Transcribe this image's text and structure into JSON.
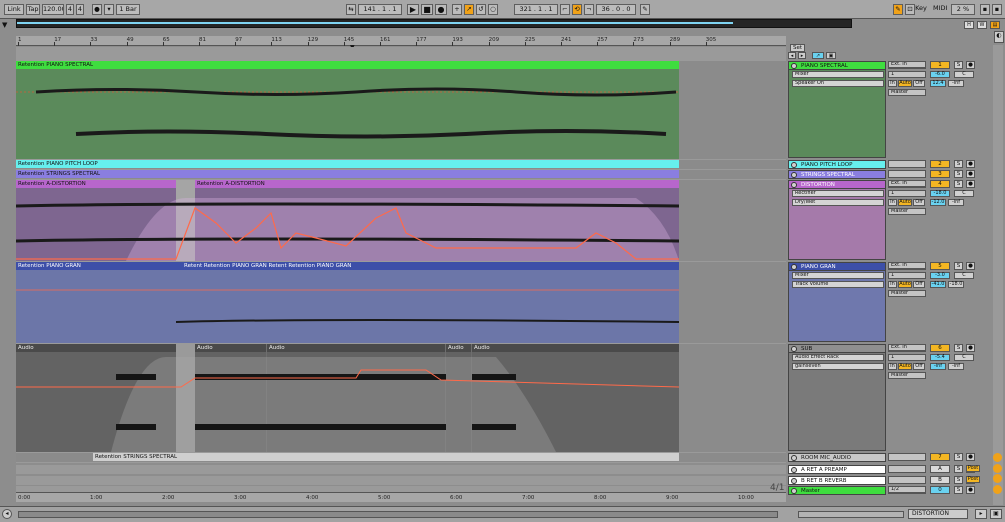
{
  "transport": {
    "link": "Link",
    "tap": "Tap",
    "tempo": "120.00",
    "sig_num": "4",
    "sig_den": "4",
    "metro": "1 Bar",
    "position": "141 . 1 . 1",
    "loop_start": "321 . 1 . 1",
    "loop_length": "36 . 0 . 0",
    "key": "Key",
    "midi": "MIDI",
    "cpu": "2 %",
    "d_label": "D"
  },
  "ruler_bars": [
    "1",
    "17",
    "33",
    "49",
    "65",
    "81",
    "97",
    "113",
    "129",
    "145",
    "161",
    "177",
    "193",
    "209",
    "225",
    "241",
    "257",
    "273",
    "289",
    "305"
  ],
  "time_marks": [
    "0:00",
    "1:00",
    "2:00",
    "3:00",
    "4:00",
    "5:00",
    "6:00",
    "7:00",
    "8:00",
    "9:00",
    "10:00"
  ],
  "set_label": "Set",
  "clips": {
    "spectral": "Retention PIANO SPECTRAL",
    "pitch": "Retention PIANO PITCH LOOP",
    "strings": "Retention STRINGS SPECTRAL",
    "dist1": "Retention A-DISTORTION",
    "dist2": "Retention A-DISTORTION",
    "gran1": "Retention PIANO GRAN",
    "gran2": "Retent Retention PIANO GRAN Retent Retention PIANO GRAN",
    "audio1": "Audio",
    "audio2": "Audio",
    "audio3": "Audio",
    "audio4": "Audio",
    "audio5": "Audio",
    "strings_bottom": "Retention STRINGS SPECTRAL"
  },
  "tracks": [
    {
      "name": "PIANO SPECTRAL",
      "color": "#3fdd3f",
      "num": "1",
      "dev1": "Mixer",
      "dev2": "Speaker On",
      "io1": "Ext. In",
      "io2": "1",
      "io3": "Master",
      "vol": "-6.0",
      "pan": "C",
      "send": "12.4",
      "sendb": "-inf"
    },
    {
      "name": "PIANO PITCH LOOP",
      "color": "#66f0ee",
      "num": "2"
    },
    {
      "name": "STRINGS SPECTRAL",
      "color": "#8a7ee0",
      "num": "3"
    },
    {
      "name": "DISTORTION",
      "color": "#b766cc",
      "num": "4",
      "dev1": "Rectifier",
      "dev2": "Dry/Wet",
      "io1": "Ext. In",
      "io2": "1",
      "io3": "Master",
      "vol": "-18.0",
      "pan": "C",
      "send": "-12.0",
      "sendb": "-inf"
    },
    {
      "name": "PIANO GRAN",
      "color": "#3d4fa8",
      "num": "5",
      "dev1": "Mixer",
      "dev2": "Track Volume",
      "io1": "Ext. In",
      "io2": "1",
      "io3": "Master",
      "vol": "-3.0",
      "pan": "C",
      "send": "-41.0",
      "sendb": "-18.0"
    },
    {
      "name": "SUB",
      "color": "#8f8f8f",
      "num": "6",
      "dev1": "Audio Effect Rack",
      "dev2": "gainseven",
      "io1": "Ext. In",
      "io2": "1",
      "io3": "Master",
      "vol": "-5.4",
      "pan": "C",
      "send": "-inf",
      "sendb": "-inf"
    },
    {
      "name": "ROOM MIC_AUDIO",
      "color": "#c8c8c8",
      "num": "7"
    },
    {
      "name": "A RET A PREAMP",
      "color": "#ffffff",
      "num": "A"
    },
    {
      "name": "B RET B REVERB",
      "color": "#ffffff",
      "num": "B"
    },
    {
      "name": "Master",
      "color": "#3fdd3f",
      "num": "0",
      "io": "1/2"
    }
  ],
  "mixer_labels": {
    "in": "In",
    "auto": "Auto",
    "off": "Off",
    "s": "S",
    "post": "Post"
  },
  "page_indicator": "4/1",
  "status_device": "DISTORTION",
  "colors": {
    "accent": "#f0a219",
    "clip_green": "#3fdd3f",
    "automation": "#ff6a4a"
  }
}
